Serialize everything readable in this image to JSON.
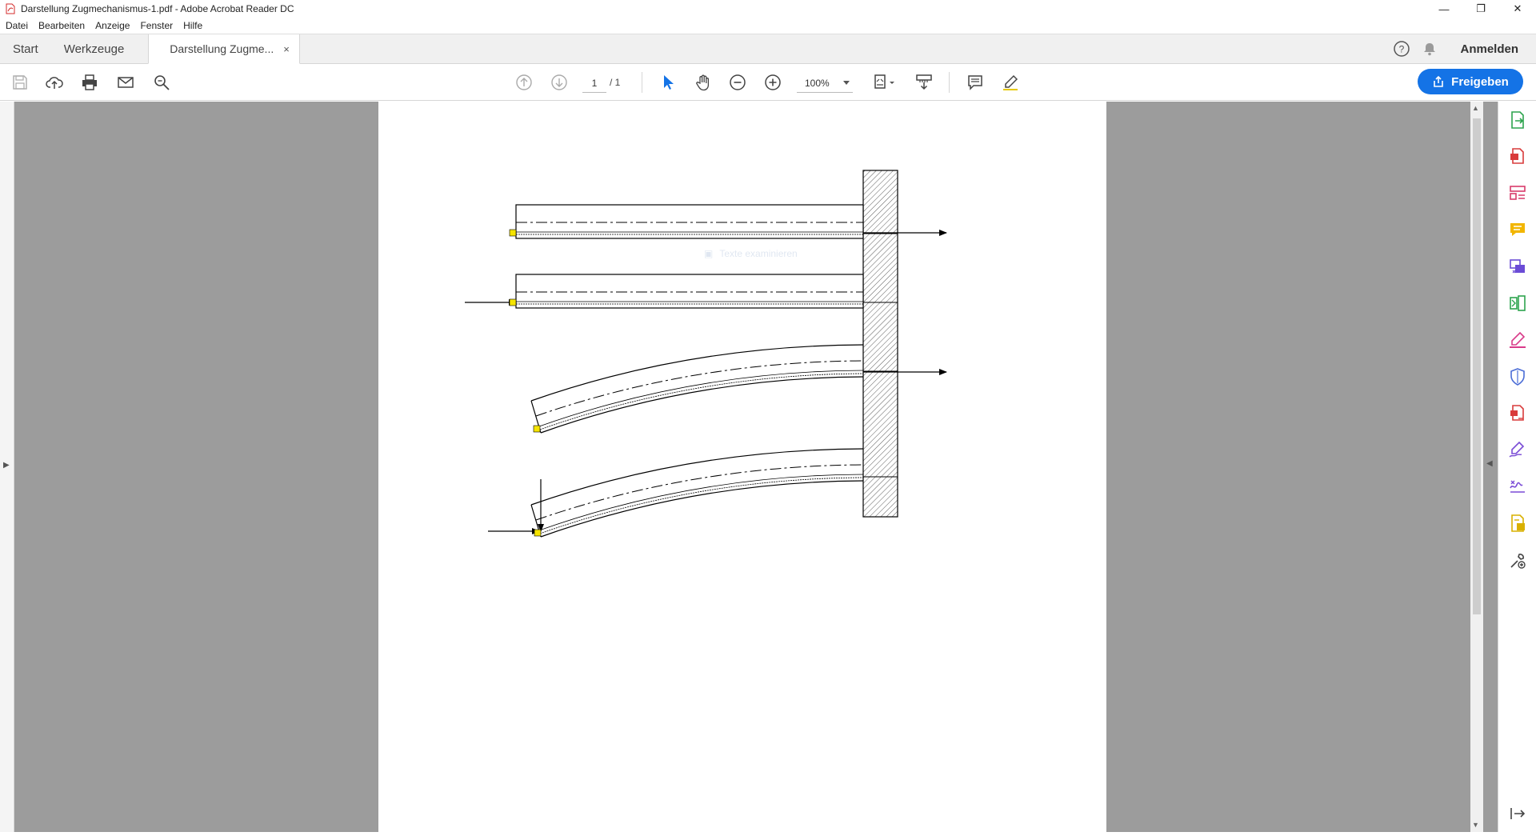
{
  "window": {
    "title": "Darstellung Zugmechanismus-1.pdf - Adobe Acrobat Reader DC",
    "controls": {
      "minimize": "—",
      "restore": "❐",
      "close": "✕"
    }
  },
  "menu": [
    "Datei",
    "Bearbeiten",
    "Anzeige",
    "Fenster",
    "Hilfe"
  ],
  "tabs": {
    "start": "Start",
    "tools": "Werkzeuge",
    "document": "Darstellung Zugme...",
    "close": "×",
    "help": "?",
    "signin": "Anmelden"
  },
  "toolbar": {
    "page_current": "1",
    "page_total": "/  1",
    "zoom": "100%",
    "share": "Freigeben"
  },
  "overlay": {
    "faint_label": "Texte examinieren"
  },
  "colors": {
    "accent": "#1473e6",
    "workspace": "#9c9c9c",
    "marker": "#f5e400"
  },
  "right_pane_icons": [
    "export-pdf-icon",
    "create-pdf-icon",
    "edit-pdf-icon",
    "comment-icon",
    "combine-files-icon",
    "organize-pages-icon",
    "fill-sign-icon",
    "protect-icon",
    "compress-pdf-icon",
    "send-for-signature-icon",
    "certificates-icon",
    "measure-icon",
    "more-tools-icon",
    "expand-pane-icon"
  ]
}
